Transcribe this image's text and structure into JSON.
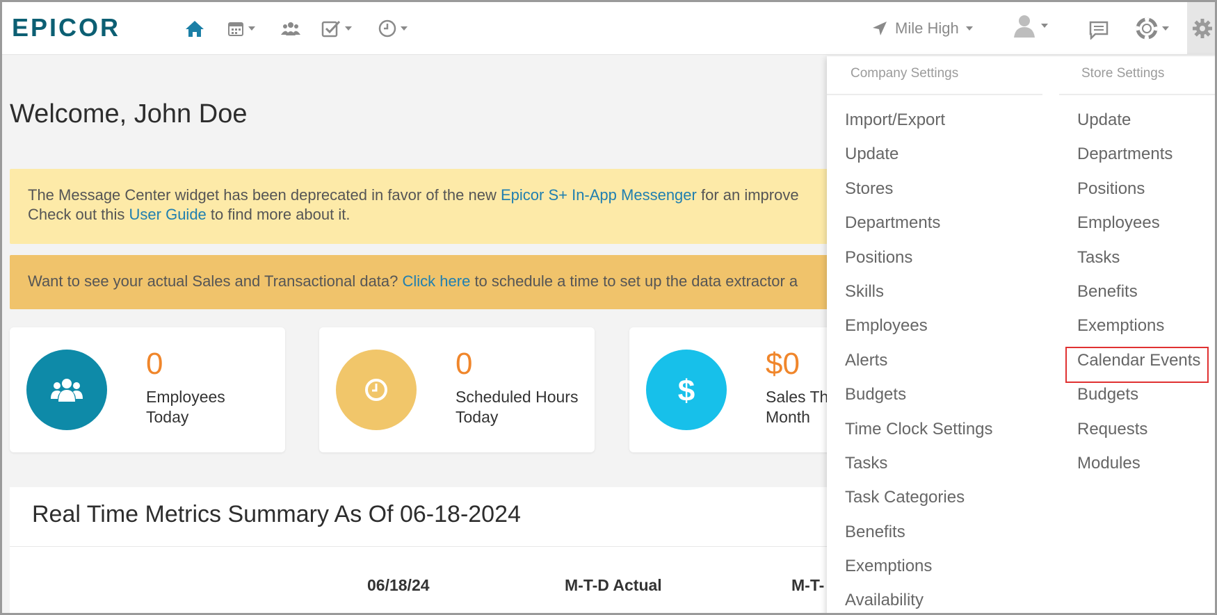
{
  "brand": {
    "logo_text": "EPICOR",
    "color": "#0c5f73"
  },
  "nav": {
    "icons": [
      "home-icon",
      "calendar-icon",
      "team-icon",
      "tasks-icon",
      "clock-icon"
    ],
    "location": "Mile High"
  },
  "welcome": "Welcome, John Doe",
  "alerts": {
    "message_center": {
      "text1": "The Message Center widget has been deprecated in favor of the new ",
      "link1": "Epicor S+ In-App Messenger",
      "text2": " for an improve",
      "text3": "Check out this ",
      "link2": "User Guide",
      "text4": " to find more about it."
    },
    "data_extractor": {
      "text1": "Want to see your actual Sales and Transactional data? ",
      "link": "Click here",
      "text2": " to schedule a time to set up the data extractor a"
    }
  },
  "stats": [
    {
      "value": "0",
      "label_line1": "Employees",
      "label_line2": "Today",
      "color": "#0e8aa8",
      "icon": "team-icon"
    },
    {
      "value": "0",
      "label_line1": "Scheduled Hours",
      "label_line2": "Today",
      "color": "#f1c66a",
      "icon": "clock-icon"
    },
    {
      "value": "$0",
      "label_line1": "Sales Th",
      "label_line2": "Month",
      "color": "#17c0ea",
      "icon": "dollar-icon"
    }
  ],
  "metrics": {
    "title": "Real Time Metrics Summary As Of  06-18-2024",
    "columns": [
      "06/18/24",
      "M-T-D Actual",
      "M-T-"
    ]
  },
  "settings_menu": {
    "company": {
      "header": "Company Settings",
      "items": [
        "Import/Export",
        "Update",
        "Stores",
        "Departments",
        "Positions",
        "Skills",
        "Employees",
        "Alerts",
        "Budgets",
        "Time Clock Settings",
        "Tasks",
        "Task Categories",
        "Benefits",
        "Exemptions",
        "Availability"
      ]
    },
    "store": {
      "header": "Store Settings",
      "items": [
        "Update",
        "Departments",
        "Positions",
        "Employees",
        "Tasks",
        "Benefits",
        "Exemptions",
        "Calendar Events",
        "Budgets",
        "Requests",
        "Modules"
      ]
    }
  }
}
